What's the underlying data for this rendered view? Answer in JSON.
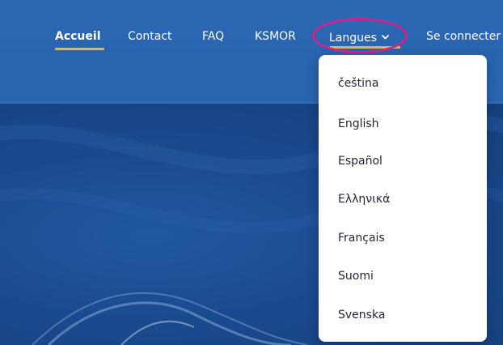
{
  "nav": {
    "items": [
      {
        "label": "Accueil"
      },
      {
        "label": "Contact"
      },
      {
        "label": "FAQ"
      },
      {
        "label": "KSMOR"
      },
      {
        "label": "Langues"
      },
      {
        "label": "Se connecter"
      }
    ],
    "active": "Accueil",
    "accent_color": "#f3b81f",
    "highlight_color": "#d2238d"
  },
  "languages": {
    "items": [
      {
        "label": "čeština"
      },
      {
        "label": "English"
      },
      {
        "label": "Español"
      },
      {
        "label": "Ελληνικά"
      },
      {
        "label": "Français"
      },
      {
        "label": "Suomi"
      },
      {
        "label": "Svenska"
      }
    ]
  },
  "icons": {
    "langues_toggle": "chevron-down-icon"
  },
  "colors": {
    "nav_background": "#2a66b2",
    "hero_background": "#1a4a8e",
    "dropdown_background": "#ffffff",
    "dropdown_text": "#1f2430"
  }
}
